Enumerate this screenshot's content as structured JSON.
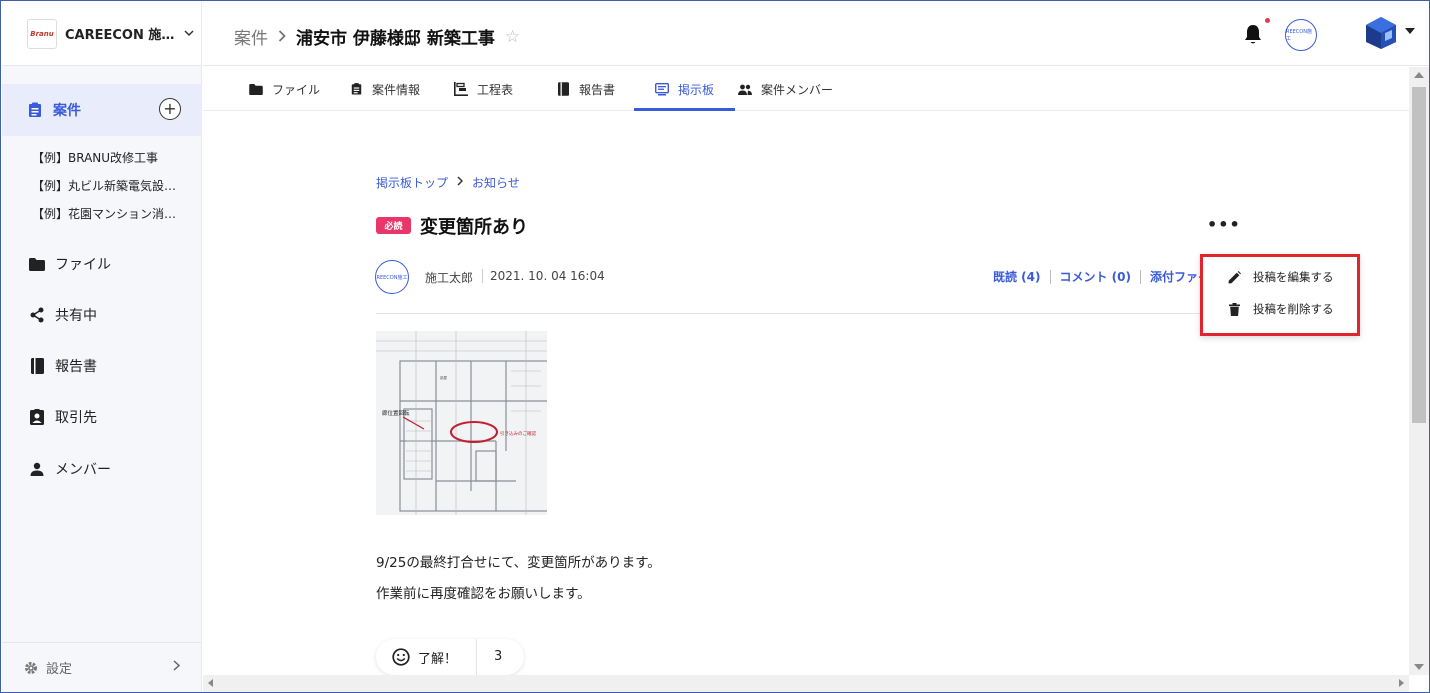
{
  "brand": {
    "logo_text": "Branu",
    "name": "CAREECON 施…",
    "menu_icon": "chevron-down-icon"
  },
  "sidebar": {
    "projects_label": "案件",
    "projects": [
      "【例】BRANU改修工事",
      "【例】丸ビル新築電気設…",
      "【例】花園マンション消…"
    ],
    "items": [
      {
        "label": "ファイル",
        "icon": "folder-icon"
      },
      {
        "label": "共有中",
        "icon": "share-icon"
      },
      {
        "label": "報告書",
        "icon": "book-icon"
      },
      {
        "label": "取引先",
        "icon": "contact-badge-icon"
      },
      {
        "label": "メンバー",
        "icon": "person-icon"
      }
    ],
    "settings_label": "設定"
  },
  "header": {
    "breadcrumb_root": "案件",
    "project_title": "浦安市 伊藤様邸 新築工事",
    "notification_dot_color": "#e53950",
    "avatar_text": "REECON施工"
  },
  "tabs": [
    {
      "label": "ファイル",
      "icon": "folder-icon",
      "active": false
    },
    {
      "label": "案件情報",
      "icon": "clipboard-icon",
      "active": false
    },
    {
      "label": "工程表",
      "icon": "gantt-icon",
      "active": false
    },
    {
      "label": "報告書",
      "icon": "book-icon",
      "active": false
    },
    {
      "label": "掲示板",
      "icon": "board-icon",
      "active": true
    },
    {
      "label": "案件メンバー",
      "icon": "people-icon",
      "active": false
    }
  ],
  "post": {
    "breadcrumb": [
      "掲示板トップ",
      "お知らせ"
    ],
    "badge": "必読",
    "title": "変更箇所あり",
    "author_avatar_text": "REECON施工",
    "author": "施工太郎",
    "date": "2021. 10. 04 16:04",
    "read_label": "既読 (4)",
    "comment_label": "コメント (0)",
    "attachment_label": "添付ファイ",
    "image_labels": {
      "left_note": "廊位置回転",
      "right_note": "引き込みのご確認",
      "tiny": "部屋"
    },
    "body_lines": [
      "9/25の最終打合せにて、変更箇所があります。",
      "作業前に再度確認をお願いします。"
    ],
    "reaction_label": "了解！",
    "reaction_count": "3"
  },
  "menu": {
    "edit": "投稿を編集する",
    "delete": "投稿を削除する"
  },
  "colors": {
    "accent": "#3a5bd9",
    "badge": "#e8366a",
    "highlight_border": "#e0252f"
  }
}
